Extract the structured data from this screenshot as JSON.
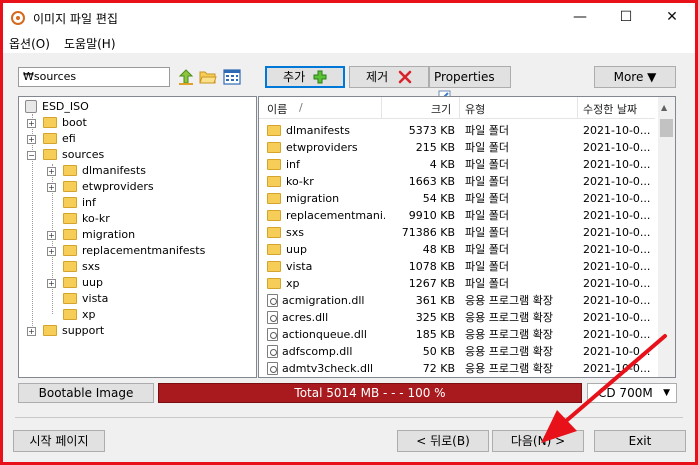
{
  "window": {
    "title": "이미지 파일 편집",
    "minimize": "—",
    "maximize": "☐",
    "close": "✕"
  },
  "menu": [
    "옵션(O)",
    "도움말(H)"
  ],
  "toolbar": {
    "path_value": "₩sources",
    "add_label": "추가",
    "remove_label": "제거",
    "properties_label": "Properties",
    "more_label": "More ▼"
  },
  "tree": {
    "root": "ESD_ISO",
    "items": [
      {
        "label": "boot",
        "expander": "+"
      },
      {
        "label": "efi",
        "expander": "+"
      },
      {
        "label": "sources",
        "expander": "−"
      },
      {
        "label": "dlmanifests",
        "expander": "+"
      },
      {
        "label": "etwproviders",
        "expander": "+"
      },
      {
        "label": "inf",
        "expander": ""
      },
      {
        "label": "ko-kr",
        "expander": ""
      },
      {
        "label": "migration",
        "expander": "+"
      },
      {
        "label": "replacementmanifests",
        "expander": "+"
      },
      {
        "label": "sxs",
        "expander": ""
      },
      {
        "label": "uup",
        "expander": "+"
      },
      {
        "label": "vista",
        "expander": ""
      },
      {
        "label": "xp",
        "expander": ""
      },
      {
        "label": "support",
        "expander": "+"
      }
    ]
  },
  "list": {
    "headers": {
      "name": "이름",
      "sort": "/",
      "size": "크기",
      "type": "유형",
      "modified": "수정한 날짜"
    },
    "rows": [
      {
        "name": "dlmanifests",
        "size": "5373 KB",
        "type": "파일 폴더",
        "date": "2021-10-0...",
        "kind": "folder"
      },
      {
        "name": "etwproviders",
        "size": "215 KB",
        "type": "파일 폴더",
        "date": "2021-10-0...",
        "kind": "folder"
      },
      {
        "name": "inf",
        "size": "4 KB",
        "type": "파일 폴더",
        "date": "2021-10-0...",
        "kind": "folder"
      },
      {
        "name": "ko-kr",
        "size": "1663 KB",
        "type": "파일 폴더",
        "date": "2021-10-0...",
        "kind": "folder"
      },
      {
        "name": "migration",
        "size": "54 KB",
        "type": "파일 폴더",
        "date": "2021-10-0...",
        "kind": "folder"
      },
      {
        "name": "replacementmani...",
        "size": "9910 KB",
        "type": "파일 폴더",
        "date": "2021-10-0...",
        "kind": "folder"
      },
      {
        "name": "sxs",
        "size": "71386 KB",
        "type": "파일 폴더",
        "date": "2021-10-0...",
        "kind": "folder"
      },
      {
        "name": "uup",
        "size": "48 KB",
        "type": "파일 폴더",
        "date": "2021-10-0...",
        "kind": "folder"
      },
      {
        "name": "vista",
        "size": "1078 KB",
        "type": "파일 폴더",
        "date": "2021-10-0...",
        "kind": "folder"
      },
      {
        "name": "xp",
        "size": "1267 KB",
        "type": "파일 폴더",
        "date": "2021-10-0...",
        "kind": "folder"
      },
      {
        "name": "acmigration.dll",
        "size": "361 KB",
        "type": "응용 프로그램 확장",
        "date": "2021-10-0...",
        "kind": "file"
      },
      {
        "name": "acres.dll",
        "size": "325 KB",
        "type": "응용 프로그램 확장",
        "date": "2021-10-0...",
        "kind": "file"
      },
      {
        "name": "actionqueue.dll",
        "size": "185 KB",
        "type": "응용 프로그램 확장",
        "date": "2021-10-0...",
        "kind": "file"
      },
      {
        "name": "adfscomp.dll",
        "size": "50 KB",
        "type": "응용 프로그램 확장",
        "date": "2021-10-0...",
        "kind": "file"
      },
      {
        "name": "admtv3check.dll",
        "size": "72 KB",
        "type": "응용 프로그램 확장",
        "date": "2021-10-0...",
        "kind": "file"
      }
    ]
  },
  "status": {
    "bootable_label": "Bootable Image",
    "progress_text": "Total   5014 MB   - - -   100 %",
    "progress_percent": 100,
    "media_select": "CD 700M"
  },
  "footer": {
    "start_page": "시작 페이지",
    "back": "< 뒤로(B)",
    "next": "다음(N) >",
    "exit": "Exit"
  },
  "colors": {
    "border": "#e8111a",
    "progress": "#a91a1e",
    "annotation_arrow": "#e8111a"
  }
}
